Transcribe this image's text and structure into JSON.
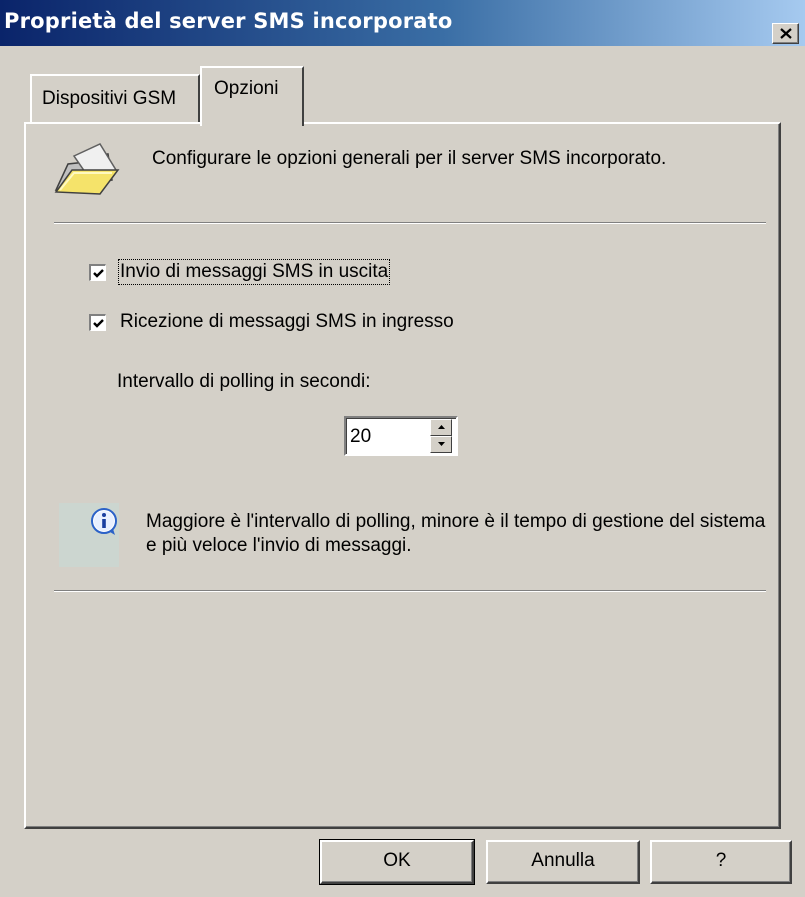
{
  "window": {
    "title": "Proprietà del server SMS incorporato",
    "close_icon": "close-icon"
  },
  "tabs": [
    {
      "label": "Dispositivi GSM",
      "selected": false
    },
    {
      "label": "Opzioni",
      "selected": true
    }
  ],
  "options": {
    "header_icon": "folder-icon",
    "description": "Configurare le opzioni generali per il server SMS incorporato.",
    "outgoing": {
      "label": "Invio di messaggi SMS in uscita",
      "checked": true
    },
    "incoming": {
      "label": "Ricezione di messaggi SMS in ingresso",
      "checked": true
    },
    "polling_label": "Intervallo di polling in secondi:",
    "polling_value": "20",
    "info_icon": "info-icon",
    "info_text": "Maggiore è l'intervallo di polling, minore è il tempo di gestione del sistema e più veloce l'invio di messaggi."
  },
  "buttons": {
    "ok": "OK",
    "cancel": "Annulla",
    "help": "?"
  },
  "colors": {
    "title_bar_start": "#0a246a",
    "title_bar_end": "#a6caf0",
    "face": "#d4d0c8"
  }
}
